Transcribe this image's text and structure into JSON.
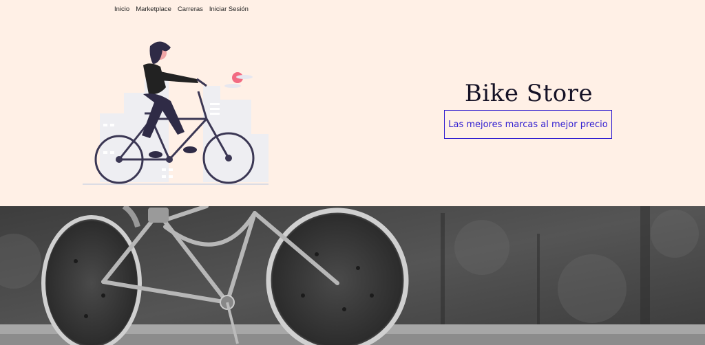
{
  "nav": {
    "items": [
      {
        "label": "Inicio"
      },
      {
        "label": "Marketplace"
      },
      {
        "label": "Carreras"
      },
      {
        "label": "Iniciar Sesión"
      }
    ]
  },
  "hero": {
    "title": "Bike Store",
    "tagline": "Las mejores marcas al mejor precio"
  },
  "colors": {
    "background": "#fff0e6",
    "accent": "#2e1bd0",
    "title": "#151226",
    "illustration_dark": "#3b3754",
    "illustration_pink": "#f26b82"
  },
  "images": {
    "hero_illustration": "woman-riding-bicycle-illustration",
    "banner_photo": "vintage-bicycle-black-and-white-photo"
  }
}
